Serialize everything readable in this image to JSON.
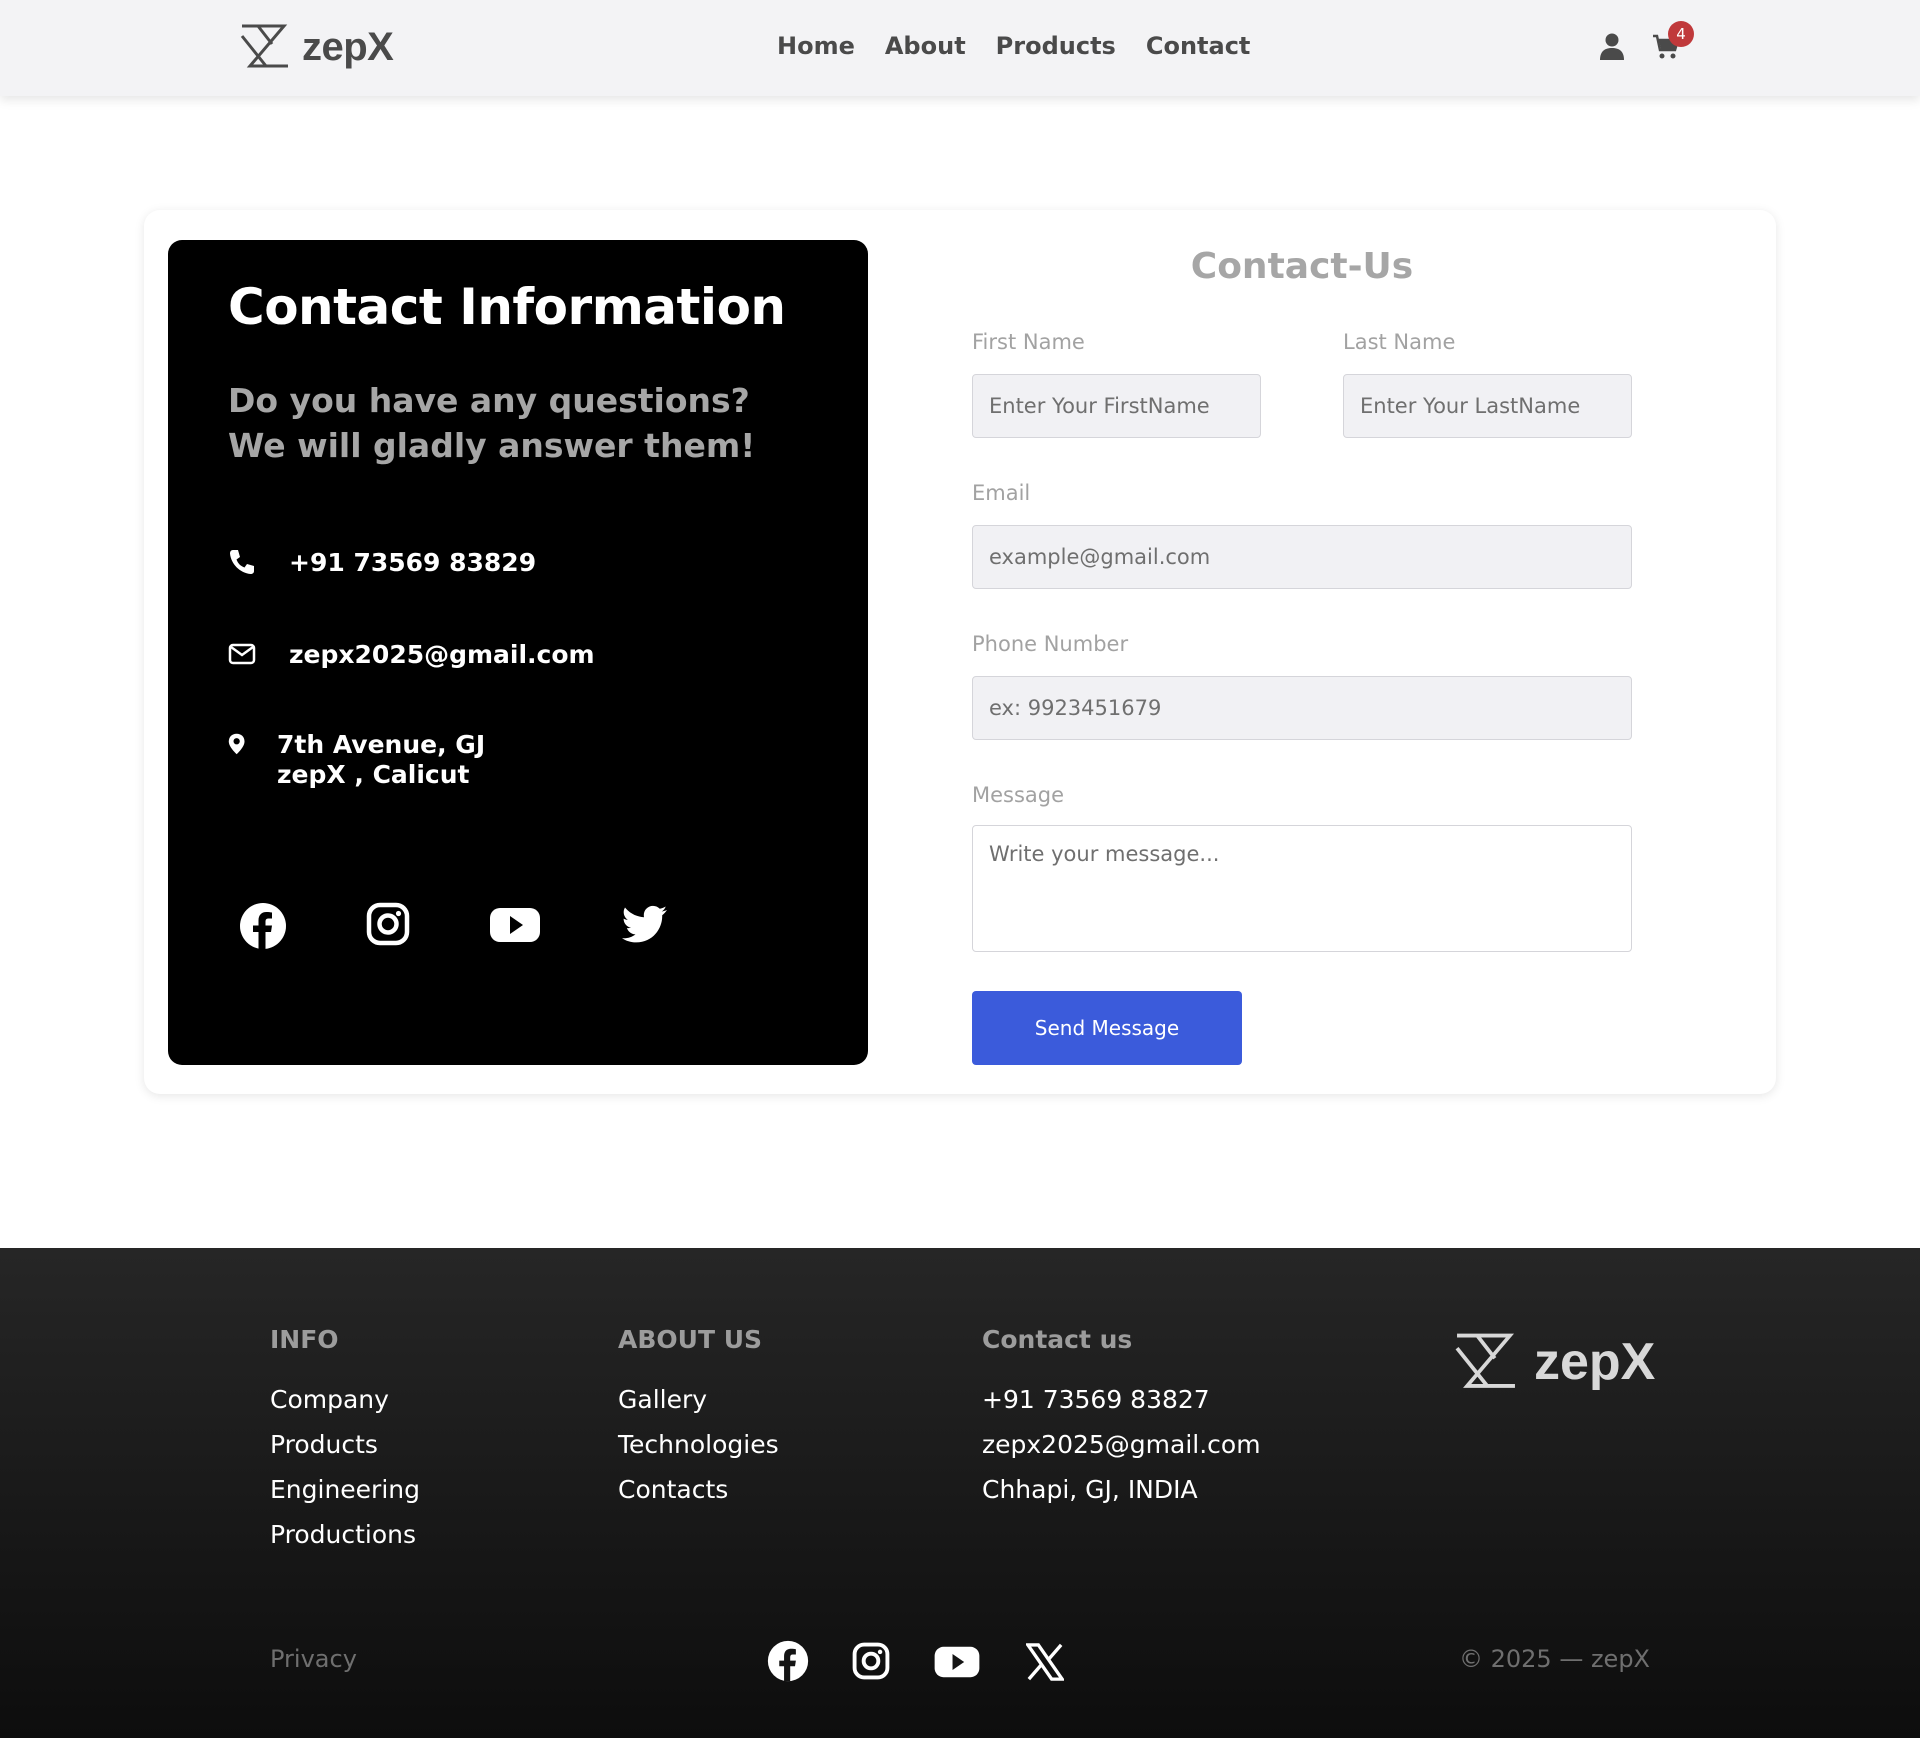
{
  "header": {
    "brand": "zepX",
    "nav": [
      "Home",
      "About",
      "Products",
      "Contact"
    ],
    "cart_count": "4",
    "icons": [
      "user-icon",
      "cart-icon"
    ]
  },
  "contact_info": {
    "title": "Contact Information",
    "subtitle_line1": "Do you have any questions?",
    "subtitle_line2": "We will gladly answer them!",
    "phone": "+91 73569 83829",
    "email": "zepx2025@gmail.com",
    "address_line1": "7th Avenue, GJ",
    "address_line2": "zepX , Calicut",
    "social": [
      "facebook-icon",
      "instagram-icon",
      "youtube-icon",
      "twitter-icon"
    ]
  },
  "form": {
    "title": "Contact-Us",
    "first_name_label": "First Name",
    "first_name_placeholder": "Enter Your FirstName",
    "last_name_label": "Last Name",
    "last_name_placeholder": "Enter Your LastName",
    "email_label": "Email",
    "email_placeholder": "example@gmail.com",
    "phone_label": "Phone Number",
    "phone_placeholder": "ex: 9923451679",
    "message_label": "Message",
    "message_placeholder": "Write your message...",
    "submit_label": "Send Message"
  },
  "footer": {
    "info_title": "INFO",
    "info_items": [
      "Company",
      "Products",
      "Engineering",
      "Productions"
    ],
    "about_title": "ABOUT US",
    "about_items": [
      "Gallery",
      "Technologies",
      "Contacts"
    ],
    "contact_title": "Contact us",
    "contact_items": [
      "+91 73569 83827",
      "zepx2025@gmail.com",
      "Chhapi, GJ, INDIA"
    ],
    "brand": "zepX",
    "privacy": "Privacy",
    "copyright": "© 2025 — zepX",
    "social": [
      "facebook-icon",
      "instagram-icon",
      "youtube-icon",
      "x-icon"
    ]
  },
  "colors": {
    "accent": "#3b5bdb",
    "badge": "#c0393b",
    "panel": "#000000",
    "footer": "#1a1a1a"
  }
}
